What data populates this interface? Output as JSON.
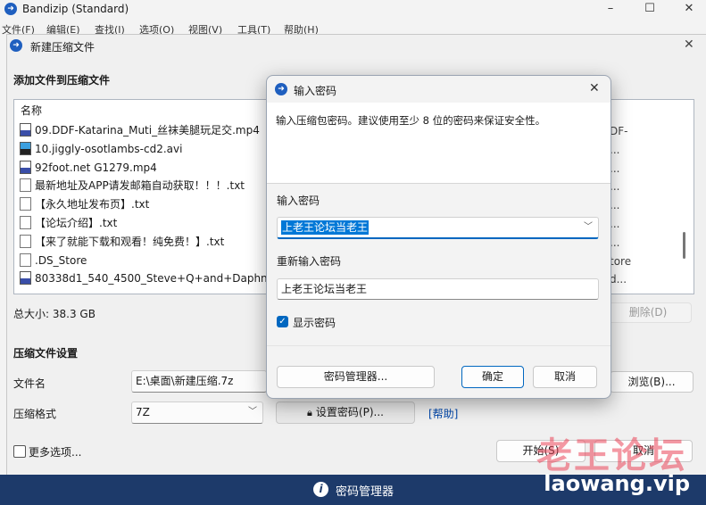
{
  "app": {
    "title": "Bandizip (Standard)"
  },
  "window_controls": {
    "minimize": "–",
    "maximize": "☐",
    "close": "✕"
  },
  "menu": [
    "文件(F)",
    "编辑(E)",
    "查找(I)",
    "选项(O)",
    "视图(V)",
    "工具(T)",
    "帮助(H)"
  ],
  "create_dialog": {
    "title": "新建压缩文件",
    "add_files_label": "添加文件到压缩文件",
    "column_name": "名称",
    "files": [
      {
        "name": "09.DDF-Katarina_Muti_丝袜美腿玩足交.mp4",
        "icon": "video-file-icon",
        "type": "video"
      },
      {
        "name": "10.jiggly-osotlambs-cd2.avi",
        "icon": "avi-file-icon",
        "type": "avi"
      },
      {
        "name": "92foot.net G1279.mp4",
        "icon": "video-file-icon",
        "type": "video"
      },
      {
        "name": "最新地址及APP请发邮箱自动获取！！！.txt",
        "icon": "text-file-icon",
        "type": "doc"
      },
      {
        "name": "【永久地址发布页】.txt",
        "icon": "text-file-icon",
        "type": "doc"
      },
      {
        "name": "【论坛介绍】.txt",
        "icon": "text-file-icon",
        "type": "doc"
      },
      {
        "name": "【来了就能下载和观看！纯免费！】.txt",
        "icon": "text-file-icon",
        "type": "doc"
      },
      {
        "name": ".DS_Store",
        "icon": "file-icon",
        "type": "doc"
      },
      {
        "name": "80338d1_540_4500_Steve+Q+and+Daphne+",
        "icon": "video-file-icon",
        "type": "video"
      }
    ],
    "right_col_fragments": [
      "DF-",
      "...",
      "...",
      "...",
      "...",
      "...",
      "...",
      "tore",
      "d..."
    ],
    "total_size": "总大小: 38.3 GB",
    "delete_button": "删除(D)",
    "settings_label": "压缩文件设置",
    "filename_label": "文件名",
    "filename_value": "E:\\桌面\\新建压缩.7z",
    "browse_button": "浏览(B)...",
    "format_label": "压缩格式",
    "format_value": "7Z",
    "set_password_button": "设置密码(P)...",
    "help_link": "[帮助]",
    "more_options_label": "更多选项...",
    "start_button": "开始(S)",
    "cancel_button": "取消"
  },
  "password_dialog": {
    "title": "输入密码",
    "description": "输入压缩包密码。建议使用至少 8 位的密码来保证安全性。",
    "password_label": "输入密码",
    "password_value": "上老王论坛当老王",
    "reenter_label": "重新输入密码",
    "reenter_value": "上老王论坛当老王",
    "show_password_label": "显示密码",
    "show_password_checked": true,
    "manager_button": "密码管理器...",
    "ok_button": "确定",
    "cancel_button": "取消"
  },
  "bottom_bar": {
    "label": "密码管理器"
  },
  "watermark": {
    "text": "老王论坛",
    "url": "laowang.vip"
  },
  "colors": {
    "accent": "#0067c0",
    "selection": "#0078d7",
    "bottom_bar": "#1d3a6a"
  }
}
